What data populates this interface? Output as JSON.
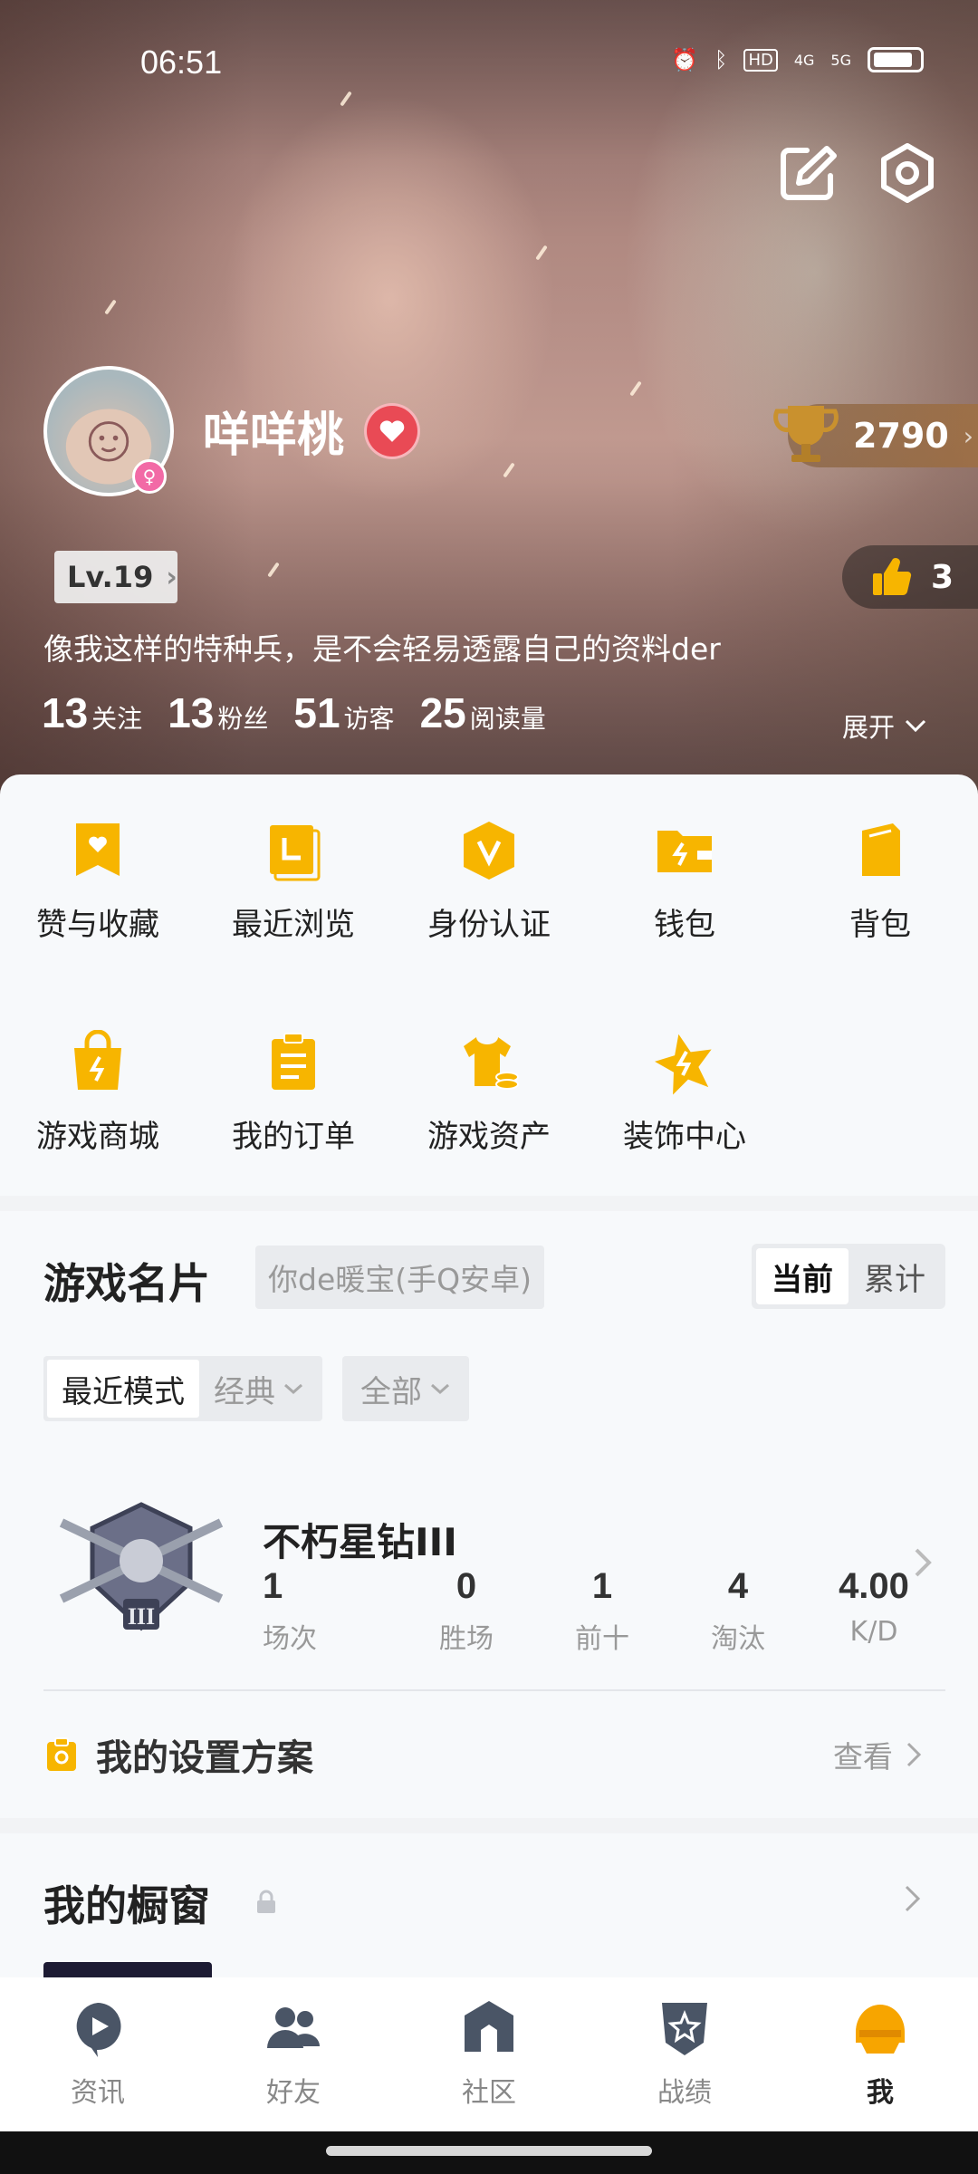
{
  "status_bar": {
    "time": "06:51",
    "icons": [
      "alarm-icon",
      "bluetooth-icon",
      "hd-icon",
      "4g-signal-icon",
      "5g-signal-icon",
      "battery-icon"
    ],
    "hd": "HD",
    "net4g": "4G",
    "net5g": "5G"
  },
  "profile": {
    "nickname": "咩咩桃",
    "level": "Lv.19",
    "trophy_score": "2790",
    "likes": "3",
    "bio": "像我这样的特种兵，是不会轻易透露自己的资料der",
    "stats": [
      {
        "num": "13",
        "label": "关注"
      },
      {
        "num": "13",
        "label": "粉丝"
      },
      {
        "num": "51",
        "label": "访客"
      },
      {
        "num": "25",
        "label": "阅读量"
      }
    ],
    "expand_label": "展开",
    "gender_symbol": "♀"
  },
  "features": [
    {
      "label": "赞与收藏",
      "icon": "heart-bookmark-icon"
    },
    {
      "label": "最近浏览",
      "icon": "recent-browse-icon"
    },
    {
      "label": "身份认证",
      "icon": "verify-v-icon"
    },
    {
      "label": "钱包",
      "icon": "wallet-icon"
    },
    {
      "label": "背包",
      "icon": "backpack-icon"
    },
    {
      "label": "游戏商城",
      "icon": "shopping-bag-icon"
    },
    {
      "label": "我的订单",
      "icon": "clipboard-icon"
    },
    {
      "label": "游戏资产",
      "icon": "tshirt-coins-icon"
    },
    {
      "label": "装饰中心",
      "icon": "star-lightning-icon"
    }
  ],
  "game_card": {
    "title": "游戏名片",
    "server": "你de暖宝(手Q安卓)",
    "toggle": [
      "当前",
      "累计"
    ],
    "mode_recent": "最近模式",
    "mode_classic": "经典",
    "filter_all": "全部",
    "rank_name": "不朽星钻III",
    "rank_stats": [
      {
        "value": "1",
        "label": "场次"
      },
      {
        "value": "0",
        "label": "胜场"
      },
      {
        "value": "1",
        "label": "前十"
      },
      {
        "value": "4",
        "label": "淘汰"
      },
      {
        "value": "4.00",
        "label": "K/D"
      }
    ],
    "settings_label": "我的设置方案",
    "settings_view": "查看"
  },
  "showcase": {
    "title": "我的橱窗"
  },
  "bottom_nav": [
    {
      "label": "资讯",
      "icon": "news-play-icon"
    },
    {
      "label": "好友",
      "icon": "friends-icon"
    },
    {
      "label": "社区",
      "icon": "community-house-icon"
    },
    {
      "label": "战绩",
      "icon": "record-shield-icon"
    },
    {
      "label": "我",
      "icon": "me-helmet-icon"
    }
  ],
  "colors": {
    "accent_yellow": "#f7b500",
    "heart_red": "#e94a55",
    "gender_pink": "#f26aa6"
  }
}
